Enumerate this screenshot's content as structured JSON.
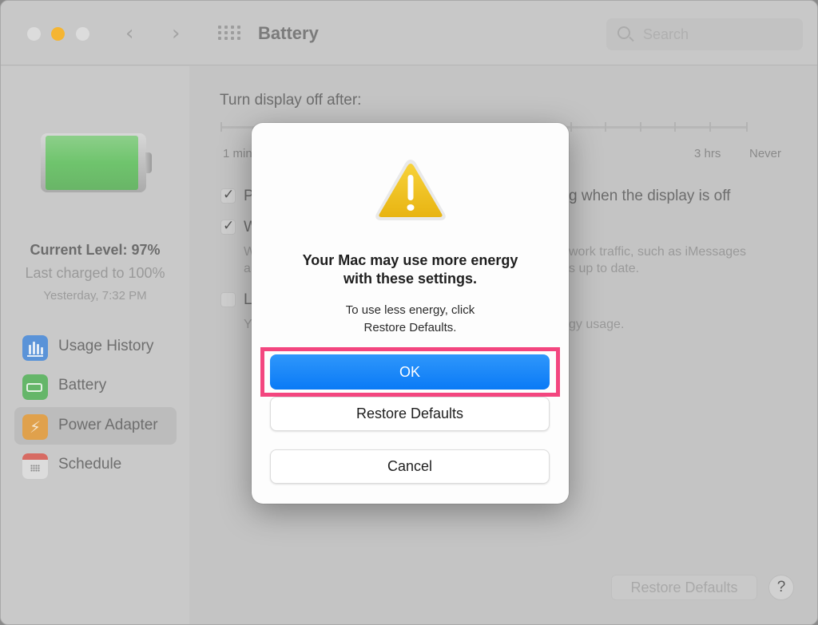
{
  "window": {
    "title": "Battery",
    "search_placeholder": "Search",
    "nav_back": "‹",
    "nav_forward": "›"
  },
  "sidebar": {
    "battery_level_percent": 97,
    "current_level": "Current Level: 97%",
    "last_charged": "Last charged to 100%",
    "last_charged_time": "Yesterday, 7:32 PM",
    "items": [
      {
        "label": "Usage History",
        "icon": "usage-history-icon",
        "selected": false
      },
      {
        "label": "Battery",
        "icon": "battery-icon",
        "selected": false
      },
      {
        "label": "Power Adapter",
        "icon": "power-adapter-icon",
        "selected": true
      },
      {
        "label": "Schedule",
        "icon": "schedule-icon",
        "selected": false
      }
    ]
  },
  "main": {
    "display_off_label": "Turn display off after:",
    "slider_ticks": [
      "1 min",
      "3 hrs",
      "Never"
    ],
    "options": [
      {
        "label_visible_start": "P",
        "label_visible_end": "g when the display is off",
        "checked": true
      },
      {
        "label_visible_start": "W",
        "desc_line1_start": "W",
        "desc_line1_end": "work traffic, such as iMessages",
        "desc_line2_start": "a",
        "desc_line2_end": "s up to date.",
        "checked": true
      },
      {
        "label_visible_start": "L",
        "desc_start": "Y",
        "desc_end": "gy usage.",
        "checked": false
      }
    ],
    "restore_defaults_label": "Restore Defaults",
    "help_label": "?"
  },
  "dialog": {
    "icon": "warning-icon",
    "title_line1": "Your Mac may use more energy",
    "title_line2": "with these settings.",
    "message_line1": "To use less energy, click",
    "message_line2": "Restore Defaults.",
    "ok_label": "OK",
    "restore_label": "Restore Defaults",
    "cancel_label": "Cancel",
    "highlight_color": "#f3467f",
    "accent_color": "#0a7af6"
  }
}
